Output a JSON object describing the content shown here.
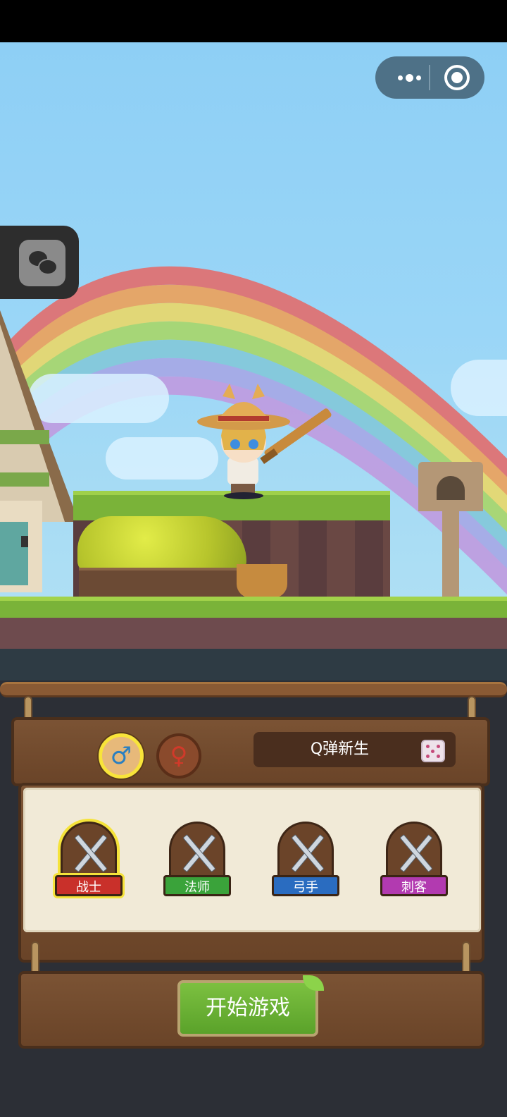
{
  "miniprogram_capsule": {
    "more_icon": "more-dots-icon",
    "close_icon": "target-close-icon"
  },
  "floating_button": {
    "icon": "wechat-icon"
  },
  "character": {
    "sprite": "straw-hat-sword-hero"
  },
  "creation": {
    "gender_options": [
      {
        "id": "male",
        "symbol": "♂",
        "selected": true
      },
      {
        "id": "female",
        "symbol": "♀",
        "selected": false
      }
    ],
    "name_value": "Q弹新生",
    "random_icon": "dice-icon",
    "classes": [
      {
        "label": "战士",
        "color": "#c9302a",
        "selected": true
      },
      {
        "label": "法师",
        "color": "#3aa33a",
        "selected": false
      },
      {
        "label": "弓手",
        "color": "#2a6cc0",
        "selected": false
      },
      {
        "label": "刺客",
        "color": "#b23ab0",
        "selected": false
      }
    ],
    "start_label": "开始游戏"
  },
  "colors": {
    "selection_highlight": "#f5e33a",
    "start_button": "#6cb236",
    "wood": "#6a4428"
  }
}
